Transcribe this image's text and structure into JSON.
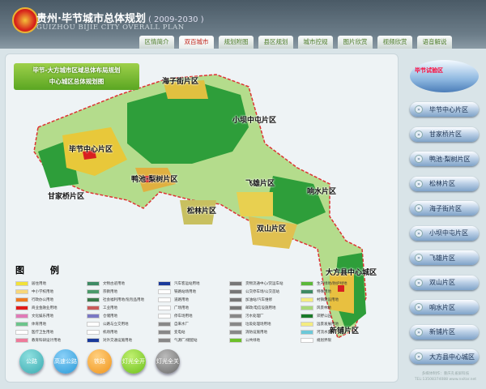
{
  "header": {
    "title_cn": "贵州·毕节城市总体规划",
    "years": "( 2009-2030 )",
    "title_en": "GUIZHOU  BIJIE CITY OVERALL PLAN"
  },
  "tabs": [
    {
      "label": "区情简介"
    },
    {
      "label": "双百城市",
      "active": true
    },
    {
      "label": "规划附图"
    },
    {
      "label": "县区规划"
    },
    {
      "label": "城市控规"
    },
    {
      "label": "图片欣赏"
    },
    {
      "label": "视频欣赏"
    },
    {
      "label": "语音解说"
    }
  ],
  "map": {
    "banner_line1": "毕节-大方城市区域总体布局规划",
    "banner_line2": "中心城区总体规划图",
    "districts": [
      "海子街片区",
      "小坝中屯片区",
      "毕节中心片区",
      "鸭池·梨树片区",
      "甘家桥片区",
      "松林片区",
      "飞雄片区",
      "响水片区",
      "双山片区",
      "大方县中心城区",
      "新铺片区"
    ]
  },
  "legend": {
    "title": "图 例",
    "items": [
      {
        "label": "居住用地",
        "color": "#f2e23a"
      },
      {
        "label": "中小学校用地",
        "color": "#f7d77a"
      },
      {
        "label": "行政办公用地",
        "color": "#ee7a22"
      },
      {
        "label": "商业金融业用地",
        "color": "#e21a1a"
      },
      {
        "label": "文化娱乐用地",
        "color": "#e07ab8"
      },
      {
        "label": "体育用地",
        "color": "#6cc48c"
      },
      {
        "label": "医疗卫生用地",
        "color": "#ffffff"
      },
      {
        "label": "教育科研设计用地",
        "color": "#ee7a9a"
      },
      {
        "label": "文物古迹用地",
        "color": "#3e8a64"
      },
      {
        "label": "宗教用地",
        "color": "#4a9a6a"
      },
      {
        "label": "社会福利用地/危险品用地",
        "color": "#3a7a4a"
      },
      {
        "label": "工业用地",
        "color": "#c85a5a"
      },
      {
        "label": "仓储用地",
        "color": "#7a78c4"
      },
      {
        "label": "公路与立交用地",
        "color": "#ffffff"
      },
      {
        "label": "机场用地",
        "color": "#ffffff"
      },
      {
        "label": "对外交通设施用地",
        "color": "#1a3a9a"
      },
      {
        "label": "汽车客运站用地",
        "color": "#1a3a9a"
      },
      {
        "label": "铁路站场用地",
        "color": "#ffffff"
      },
      {
        "label": "道路用地",
        "color": "#ffffff"
      },
      {
        "label": "广场用地",
        "color": "#ffffff"
      },
      {
        "label": "停车场用地",
        "color": "#ffffff"
      },
      {
        "label": "自来水厂",
        "color": "#888888"
      },
      {
        "label": "变电站",
        "color": "#888888"
      },
      {
        "label": "气源厂/储配站",
        "color": "#888888"
      },
      {
        "label": "货物流通中心/货运车站",
        "color": "#777777"
      },
      {
        "label": "公交停车场/公交首站",
        "color": "#777777"
      },
      {
        "label": "加油站/汽车维修",
        "color": "#777777"
      },
      {
        "label": "邮政/电信设施用地",
        "color": "#777777"
      },
      {
        "label": "污水处理厂",
        "color": "#888888"
      },
      {
        "label": "垃圾处理场用地",
        "color": "#888888"
      },
      {
        "label": "消防设施用地",
        "color": "#888888"
      },
      {
        "label": "公共绿地",
        "color": "#6cc02a"
      },
      {
        "label": "生产绿地/防护绿地",
        "color": "#5cb83a"
      },
      {
        "label": "特殊用地",
        "color": "#3e8a64"
      },
      {
        "label": "村镇建设用地",
        "color": "#f4ec80"
      },
      {
        "label": "风景林地",
        "color": "#a8d878"
      },
      {
        "label": "郊野公园",
        "color": "#1a7a2a"
      },
      {
        "label": "远景发展用地",
        "color": "#f4ec80"
      },
      {
        "label": "河流水面",
        "color": "#6cc8d8"
      },
      {
        "label": "规划界限",
        "color": "#ffffff"
      }
    ]
  },
  "round_buttons": [
    {
      "label": "公路",
      "color": "#3aaab0"
    },
    {
      "label": "高速公路",
      "color": "#2a9ad8"
    },
    {
      "label": "铁路",
      "color": "#f0941a"
    },
    {
      "label": "灯光全开",
      "color": "#6cbf1a"
    },
    {
      "label": "灯光全关",
      "color": "#6a6a6a"
    }
  ],
  "sidebar": {
    "blimp_text": "毕节试验区",
    "items": [
      "毕节中心片区",
      "甘家桥片区",
      "鸭池·梨树片区",
      "松林片区",
      "海子街片区",
      "小坝中屯片区",
      "飞雄片区",
      "双山片区",
      "响水片区",
      "新铺片区",
      "大方县中心城区"
    ],
    "credit_line1": "多媒体制作：重庆孔雀屏科技",
    "credit_line2": "TEL:13508374088  www.nxitar.net"
  }
}
